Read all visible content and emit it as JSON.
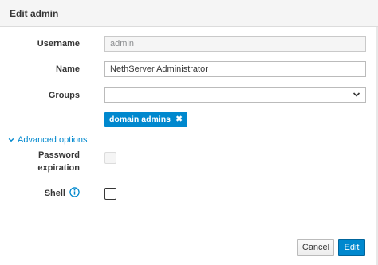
{
  "dialog": {
    "title": "Edit admin"
  },
  "form": {
    "username": {
      "label": "Username",
      "value": "admin"
    },
    "name": {
      "label": "Name",
      "value": "NethServer Administrator"
    },
    "groups": {
      "label": "Groups",
      "value": "",
      "chips": [
        "domain admins"
      ]
    },
    "advanced_options_label": "Advanced options",
    "password_expiration": {
      "label_line1": "Password",
      "label_line2": "expiration",
      "checked": false,
      "disabled": true
    },
    "shell": {
      "label": "Shell",
      "checked": false
    }
  },
  "buttons": {
    "cancel": "Cancel",
    "edit": "Edit"
  },
  "colors": {
    "accent": "#0088ce",
    "header_bg": "#f5f5f5"
  },
  "icons": {
    "chip_remove": "close-icon",
    "advanced_toggle": "chevron-down-icon",
    "shell_info": "info-icon",
    "select_caret": "chevron-down-icon"
  }
}
